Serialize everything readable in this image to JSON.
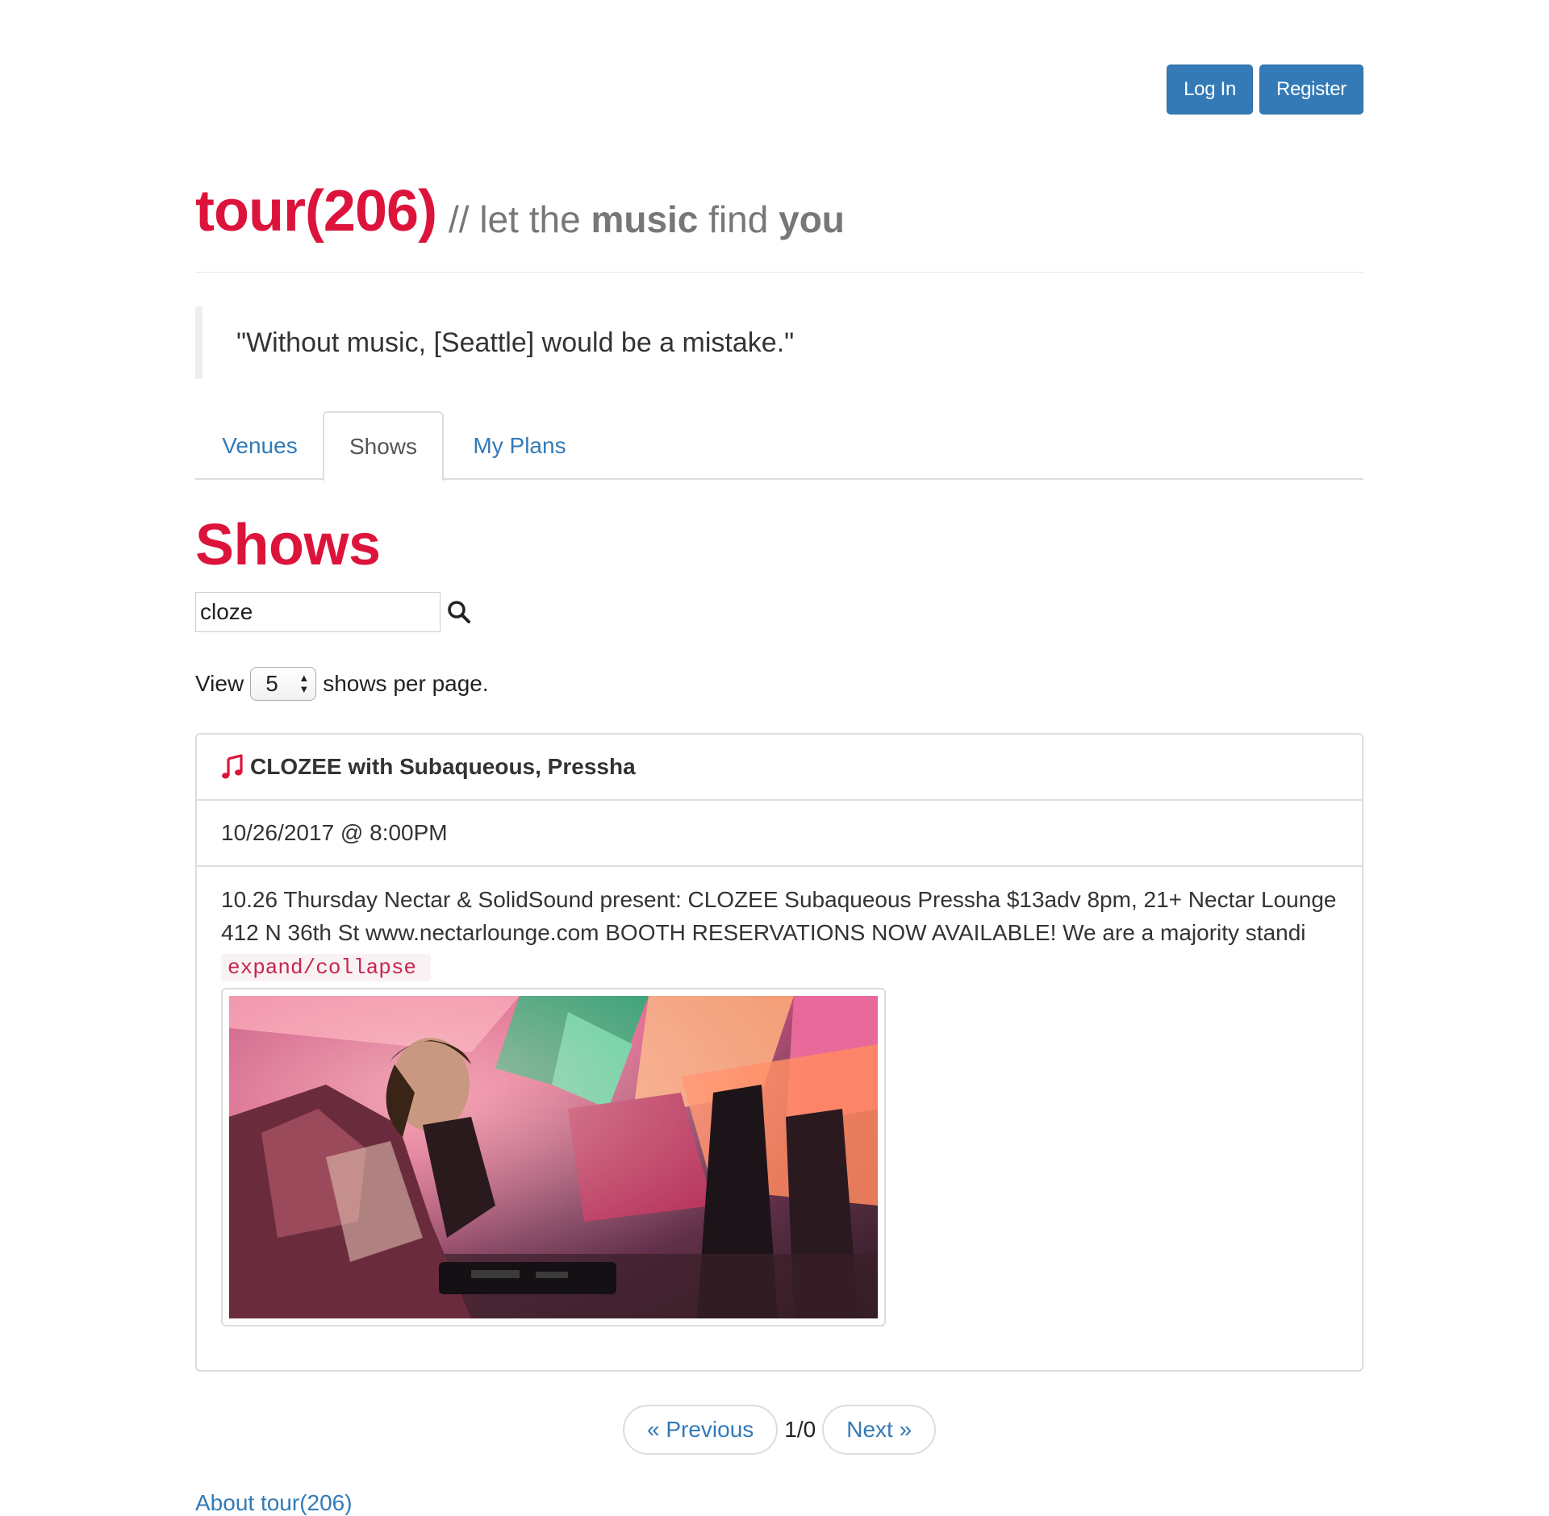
{
  "auth": {
    "login_label": "Log In",
    "register_label": "Register"
  },
  "header": {
    "brand": "tour(206)",
    "tagline_prefix": "// let the ",
    "tagline_bold1": "music",
    "tagline_mid": " find ",
    "tagline_bold2": "you"
  },
  "quote": "\"Without music, [Seattle] would be a mistake.\"",
  "tabs": [
    {
      "label": "Venues",
      "active": false
    },
    {
      "label": "Shows",
      "active": true
    },
    {
      "label": "My Plans",
      "active": false
    }
  ],
  "section_title": "Shows",
  "search": {
    "value": "cloze"
  },
  "per_page": {
    "prefix": "View",
    "value": "5",
    "suffix": "shows per page."
  },
  "show": {
    "title": "CLOZEE with Subaqueous, Pressha",
    "datetime": "10/26/2017 @ 8:00PM",
    "description": "10.26 Thursday Nectar & SolidSound present: CLOZEE Subaqueous Pressha $13adv 8pm, 21+ Nectar Lounge 412 N 36th St www.nectarlounge.com BOOTH RESERVATIONS NOW AVAILABLE! We are a majority standi",
    "toggle_label": "expand/collapse"
  },
  "pager": {
    "previous_label": "« Previous",
    "count": "1/0",
    "next_label": "Next »"
  },
  "footer": {
    "about_label": "About tour(206)"
  },
  "colors": {
    "brand": "#dc143c",
    "link": "#337ab7",
    "button": "#337ab7"
  }
}
